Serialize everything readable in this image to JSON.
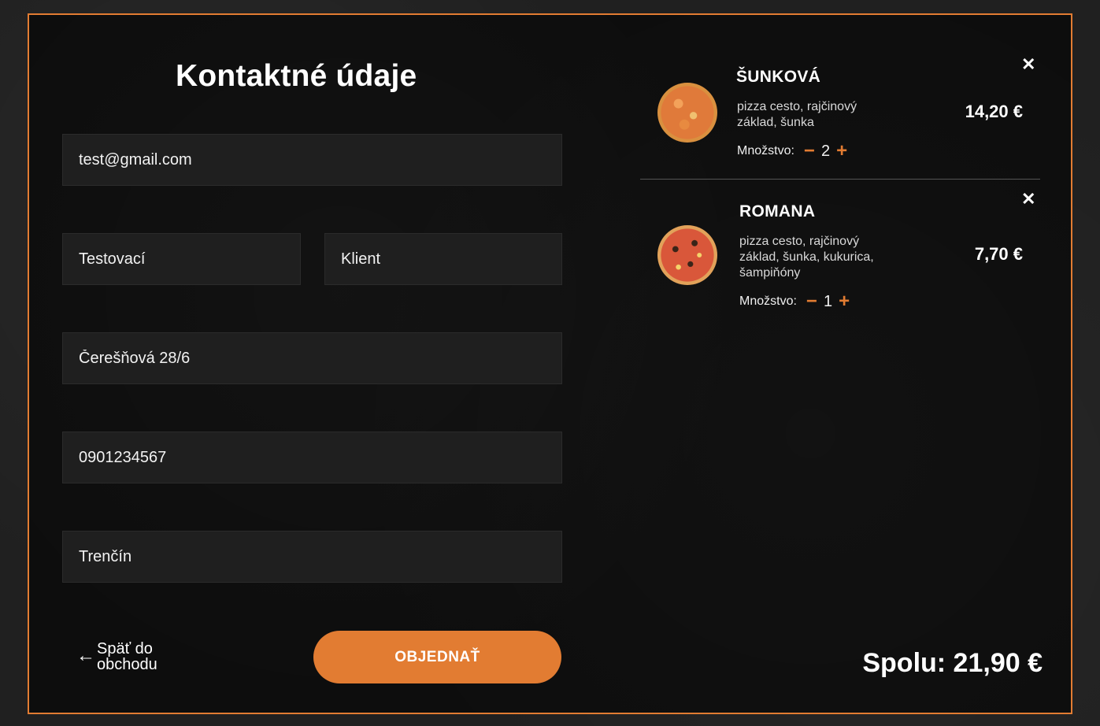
{
  "form": {
    "title": "Kontaktné údaje",
    "email": "test@gmail.com",
    "first_name": "Testovací",
    "last_name": "Klient",
    "street": "Čerešňová 28/6",
    "phone": "0901234567",
    "city": "Trenčín",
    "back_label": "Späť do obchodu",
    "order_label": "OBJEDNAŤ"
  },
  "cart": {
    "qty_label": "Množstvo:",
    "items": [
      {
        "name": "ŠUNKOVÁ",
        "description": "pizza cesto, rajčinový základ, šunka",
        "quantity": "2",
        "price": "14,20 €",
        "image": "pizza-sunkova"
      },
      {
        "name": "ROMANA",
        "description": "pizza cesto, rajčinový základ, šunka, kukurica, šampiňóny",
        "quantity": "1",
        "price": "7,70 €",
        "image": "pizza-romana"
      }
    ],
    "total": "Spolu: 21,90 €"
  },
  "icons": {
    "close": "close-icon",
    "back_arrow": "arrow-left-icon",
    "minus": "minus-icon",
    "plus": "plus-icon"
  },
  "colors": {
    "accent": "#e27c32",
    "panel_bg": "#0d0d0d",
    "field_bg": "#1f1f1f"
  }
}
